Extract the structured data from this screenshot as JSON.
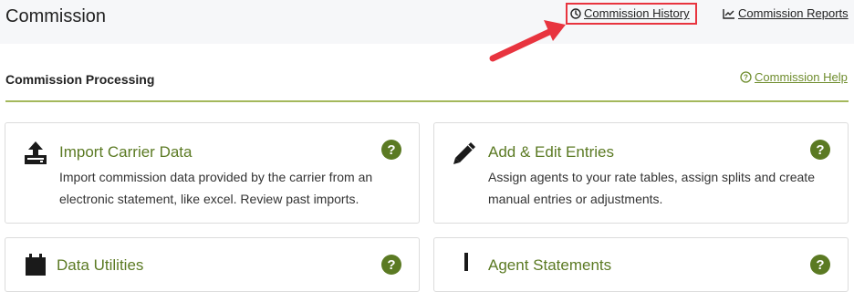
{
  "header": {
    "title": "Commission",
    "links": {
      "history": "Commission History",
      "reports": "Commission Reports"
    }
  },
  "section": {
    "title": "Commission Processing",
    "help_link": "Commission Help"
  },
  "cards": [
    {
      "title": "Import Carrier Data",
      "description": "Import commission data provided by the carrier from an electronic statement, like excel. Review past imports.",
      "icon": "upload-tray-icon"
    },
    {
      "title": "Add & Edit Entries",
      "description": "Assign agents to your rate tables, assign splits and create manual entries or adjustments.",
      "icon": "pencil-icon"
    },
    {
      "title": "Data Utilities",
      "icon": "calendar-icon"
    },
    {
      "title": "Agent Statements",
      "icon": "download-icon"
    }
  ],
  "colors": {
    "accent": "#5b7a23",
    "help_circle": "#6f8d2e",
    "rule": "#a4b85c",
    "highlight": "#e8343f",
    "header_bg": "#f6f7f9"
  }
}
